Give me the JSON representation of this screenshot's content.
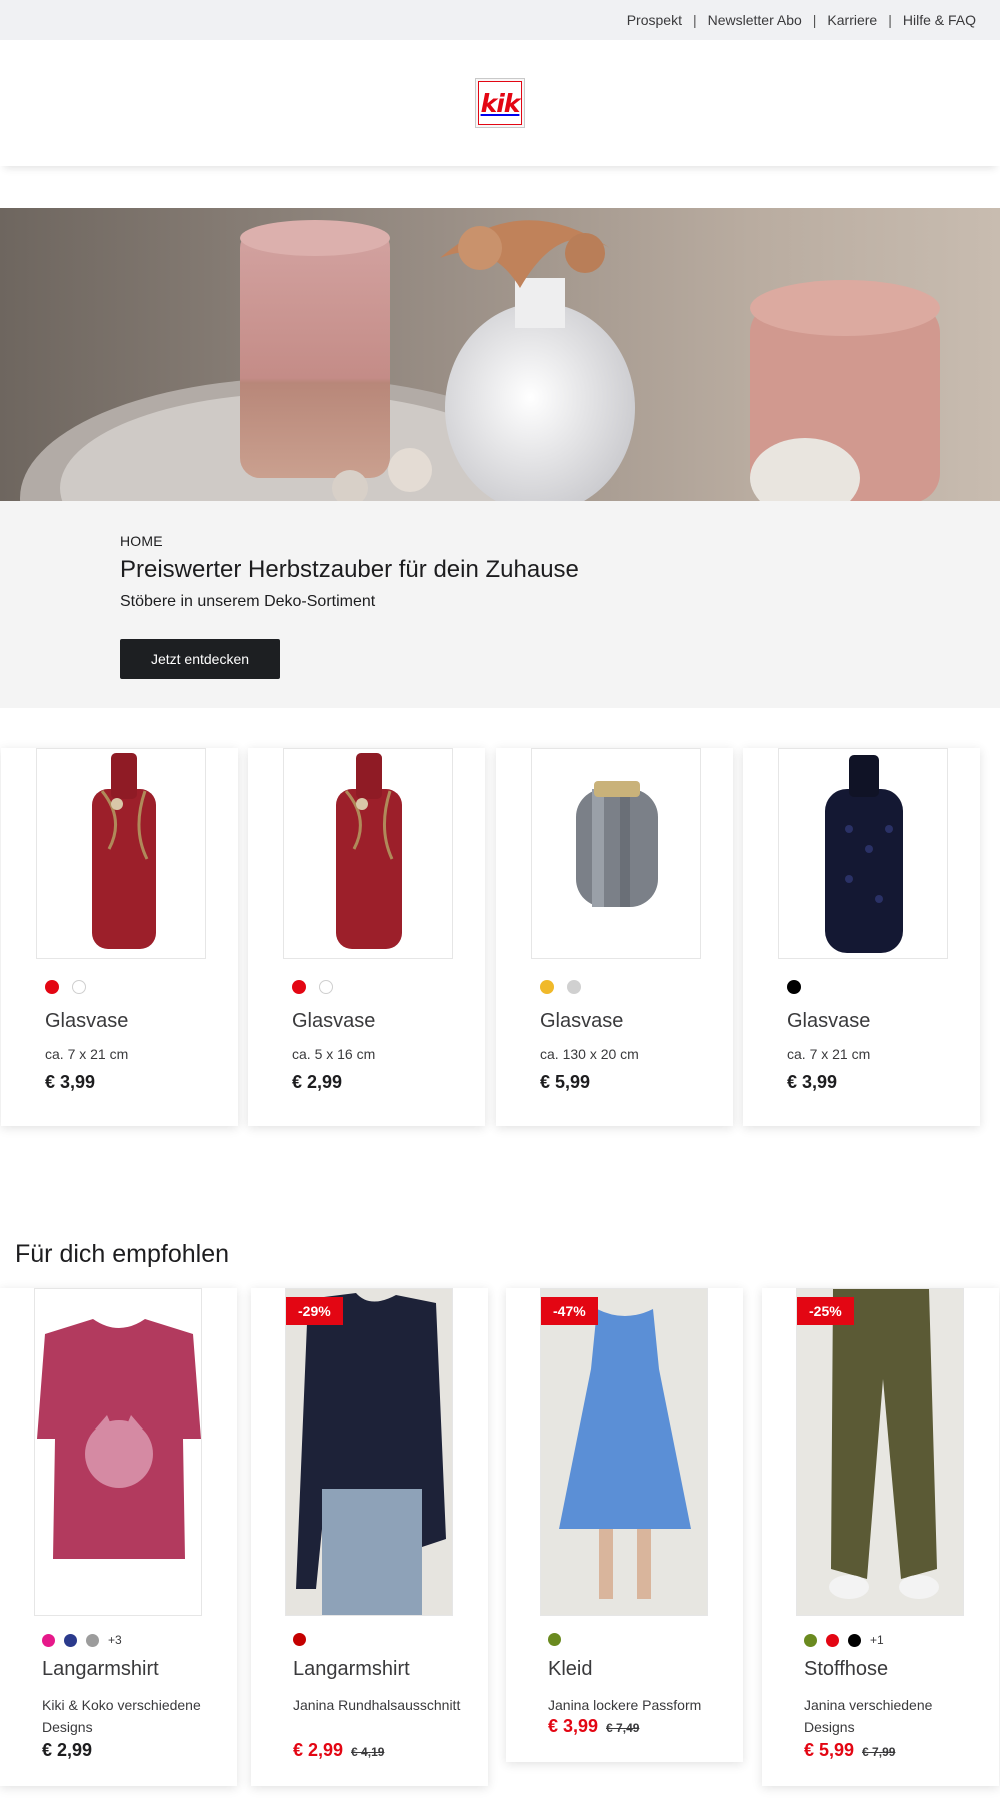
{
  "topnav": {
    "links": [
      "Prospekt",
      "Newsletter Abo",
      "Karriere",
      "Hilfe & FAQ"
    ],
    "separator": "|"
  },
  "header": {
    "logo_text": "kik",
    "brand_color": "#e30613"
  },
  "hero": {
    "image": "candles-vase-decor-photo"
  },
  "banner": {
    "breadcrumb": "HOME",
    "title": "Preiswerter Herbstzauber für dein Zuhause",
    "subtitle": "Stöbere in unserem Deko-Sortiment",
    "cta_label": "Jetzt entdecken"
  },
  "products": [
    {
      "name": "Glasvase",
      "size": "ca. 7 x 21 cm",
      "price": "€ 3,99",
      "colors": [
        "#e30613",
        "#ffffff"
      ]
    },
    {
      "name": "Glasvase",
      "size": "ca. 5 x 16 cm",
      "price": "€ 2,99",
      "colors": [
        "#e30613",
        "#ffffff"
      ]
    },
    {
      "name": "Glasvase",
      "size": "ca. 130 x 20 cm",
      "price": "€ 5,99",
      "colors": [
        "#f0b92a",
        "#d0d0d0"
      ]
    },
    {
      "name": "Glasvase",
      "size": "ca. 7 x 21 cm",
      "price": "€ 3,99",
      "colors": [
        "#000000"
      ]
    }
  ],
  "recommended": {
    "title": "Für dich empfohlen",
    "items": [
      {
        "name": "Langarmshirt",
        "desc": "Kiki & Koko verschiedene Designs",
        "price": "€ 2,99",
        "old_price": "",
        "badge": "",
        "colors": [
          "#e6198a",
          "#2b3a8c",
          "#9c9c9c"
        ],
        "more": "+3"
      },
      {
        "name": "Langarmshirt",
        "desc": "Janina Rundhalsausschnitt",
        "price": "€ 2,99",
        "old_price": "€ 4,19",
        "badge": "-29%",
        "colors": [
          "#c40000"
        ],
        "more": ""
      },
      {
        "name": "Kleid",
        "desc": "Janina lockere Passform",
        "price": "€ 3,99",
        "old_price": "€ 7,49",
        "badge": "-47%",
        "colors": [
          "#6a8a1f"
        ],
        "more": ""
      },
      {
        "name": "Stoffhose",
        "desc": "Janina verschiedene Designs",
        "price": "€ 5,99",
        "old_price": "€ 7,99",
        "badge": "-25%",
        "colors": [
          "#6a8a1f",
          "#e30613",
          "#000000"
        ],
        "more": "+1"
      }
    ]
  }
}
